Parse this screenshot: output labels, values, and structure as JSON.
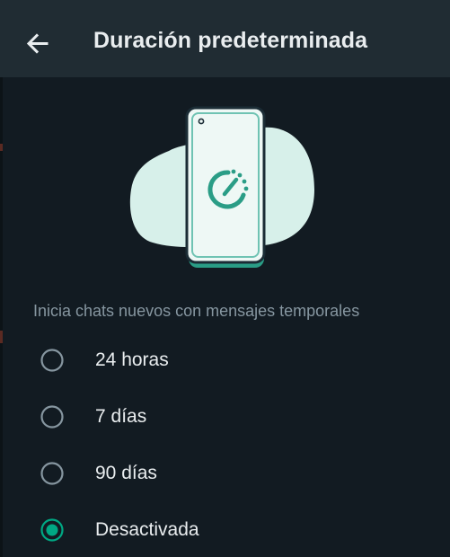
{
  "header": {
    "title": "Duración predeterminada",
    "back_icon": "arrow-left-icon"
  },
  "illustration": {
    "icon": "phone-timer-illustration",
    "accent_color": "#2a9d86",
    "blob_color": "#d7f0ea"
  },
  "section": {
    "label": "Inicia chats nuevos con mensajes temporales"
  },
  "options": [
    {
      "label": "24 horas",
      "selected": false
    },
    {
      "label": "7 días",
      "selected": false
    },
    {
      "label": "90 días",
      "selected": false
    },
    {
      "label": "Desactivada",
      "selected": true
    }
  ],
  "colors": {
    "background": "#121b22",
    "toolbar": "#202c33",
    "accent": "#00a884",
    "text_primary": "#e9edef",
    "text_secondary": "#8696a0",
    "radio_unselected": "#8696a0"
  }
}
